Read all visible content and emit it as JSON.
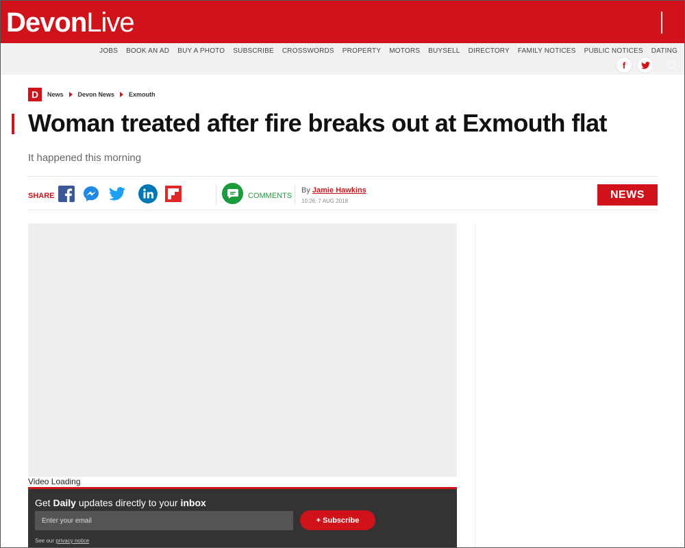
{
  "header": {
    "logo_bold": "Devon",
    "logo_light": "Live",
    "util_links": [
      "JOBS",
      "BOOK AN AD",
      "BUY A PHOTO",
      "SUBSCRIBE",
      "CROSSWORDS",
      "PROPERTY",
      "MOTORS",
      "BUYSELL",
      "DIRECTORY",
      "FAMILY NOTICES",
      "PUBLIC NOTICES",
      "DATING"
    ],
    "social": {
      "facebook": "f",
      "twitter": "t"
    }
  },
  "breadcrumb": {
    "logo": "D",
    "items": [
      "News",
      "Devon News",
      "Exmouth"
    ]
  },
  "article": {
    "title": "Woman treated after fire breaks out at Exmouth flat",
    "subtitle": "It happened this morning",
    "share_label": "SHARE",
    "comments_label": "COMMENTS",
    "by": "By",
    "author": "Jamie Hawkins",
    "timestamp": "10:26, 7 AUG 2018",
    "section_badge": "NEWS",
    "video_status": "Video Loading"
  },
  "newsletter": {
    "heading_prefix": "Get",
    "heading_daily": "Daily",
    "heading_middle": "updates directly to your",
    "heading_inbox": "inbox",
    "email_placeholder": "Enter your email",
    "subscribe_label": "+ Subscribe",
    "note_prefix": "See our",
    "privacy_link": "privacy notice"
  },
  "colors": {
    "brand_red": "#d0121b",
    "comments_green": "#1a9c3c",
    "facebook_blue": "#3b5998",
    "twitter_blue": "#1da1f2",
    "linkedin_blue": "#0077b5"
  }
}
